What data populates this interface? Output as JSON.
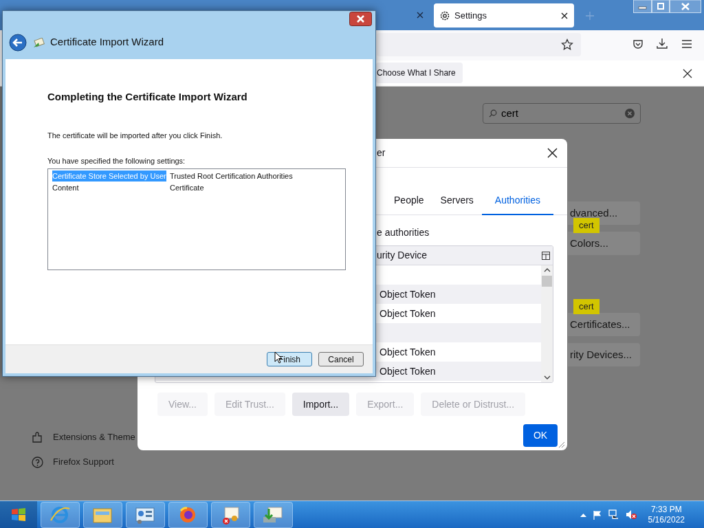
{
  "browser": {
    "tabs": [
      {
        "label": "Settings",
        "selected": true
      }
    ],
    "notification": {
      "button": "Choose What I Share"
    },
    "search": {
      "value": "cert"
    },
    "settings_buttons": [
      {
        "label": "dvanced..."
      },
      {
        "label": "Colors...",
        "tooltip": "cert"
      },
      {
        "label": "Certificates...",
        "tooltip": "cert"
      },
      {
        "label": "rity Devices..."
      }
    ],
    "sidebar": [
      {
        "kind": "extensions",
        "label": "Extensions & Theme"
      },
      {
        "kind": "support",
        "label": "Firefox Support"
      }
    ]
  },
  "certificate_manager": {
    "title": "er",
    "tabs": [
      {
        "label": "People",
        "selected": false
      },
      {
        "label": "Servers",
        "selected": false
      },
      {
        "label": "Authorities",
        "selected": true
      }
    ],
    "intro": "e authorities",
    "column": "urity Device",
    "rows": [
      {
        "kind": "group"
      },
      {
        "kind": "cert",
        "device": "Object Token"
      },
      {
        "kind": "cert",
        "device": "Object Token"
      },
      {
        "kind": "group"
      },
      {
        "kind": "cert",
        "device": "Object Token"
      },
      {
        "kind": "cert",
        "device": "Object Token"
      }
    ],
    "buttons": [
      {
        "label": "View...",
        "disabled": true
      },
      {
        "label": "Edit Trust...",
        "disabled": true
      },
      {
        "label": "Import...",
        "disabled": false
      },
      {
        "label": "Export...",
        "disabled": true
      },
      {
        "label": "Delete or Distrust...",
        "disabled": true
      }
    ],
    "ok": "OK"
  },
  "wizard": {
    "title": "Certificate Import Wizard",
    "heading": "Completing the Certificate Import Wizard",
    "message": "The certificate will be imported after you click Finish.",
    "settings_label": "You have specified the following settings:",
    "settings": [
      {
        "name": "Certificate Store Selected by User",
        "value": "Trusted Root Certification Authorities",
        "selected": true
      },
      {
        "name": "Content",
        "value": "Certificate",
        "selected": false
      }
    ],
    "buttons": [
      {
        "label": "Finish",
        "default": true
      },
      {
        "label": "Cancel",
        "default": false
      }
    ]
  },
  "taskbar": {
    "apps": [
      {
        "kind": "ie"
      },
      {
        "kind": "explorer"
      },
      {
        "kind": "control"
      },
      {
        "kind": "firefox"
      },
      {
        "kind": "certerror"
      },
      {
        "kind": "certimport"
      }
    ],
    "time": "7:33 PM",
    "date": "5/16/2022"
  }
}
